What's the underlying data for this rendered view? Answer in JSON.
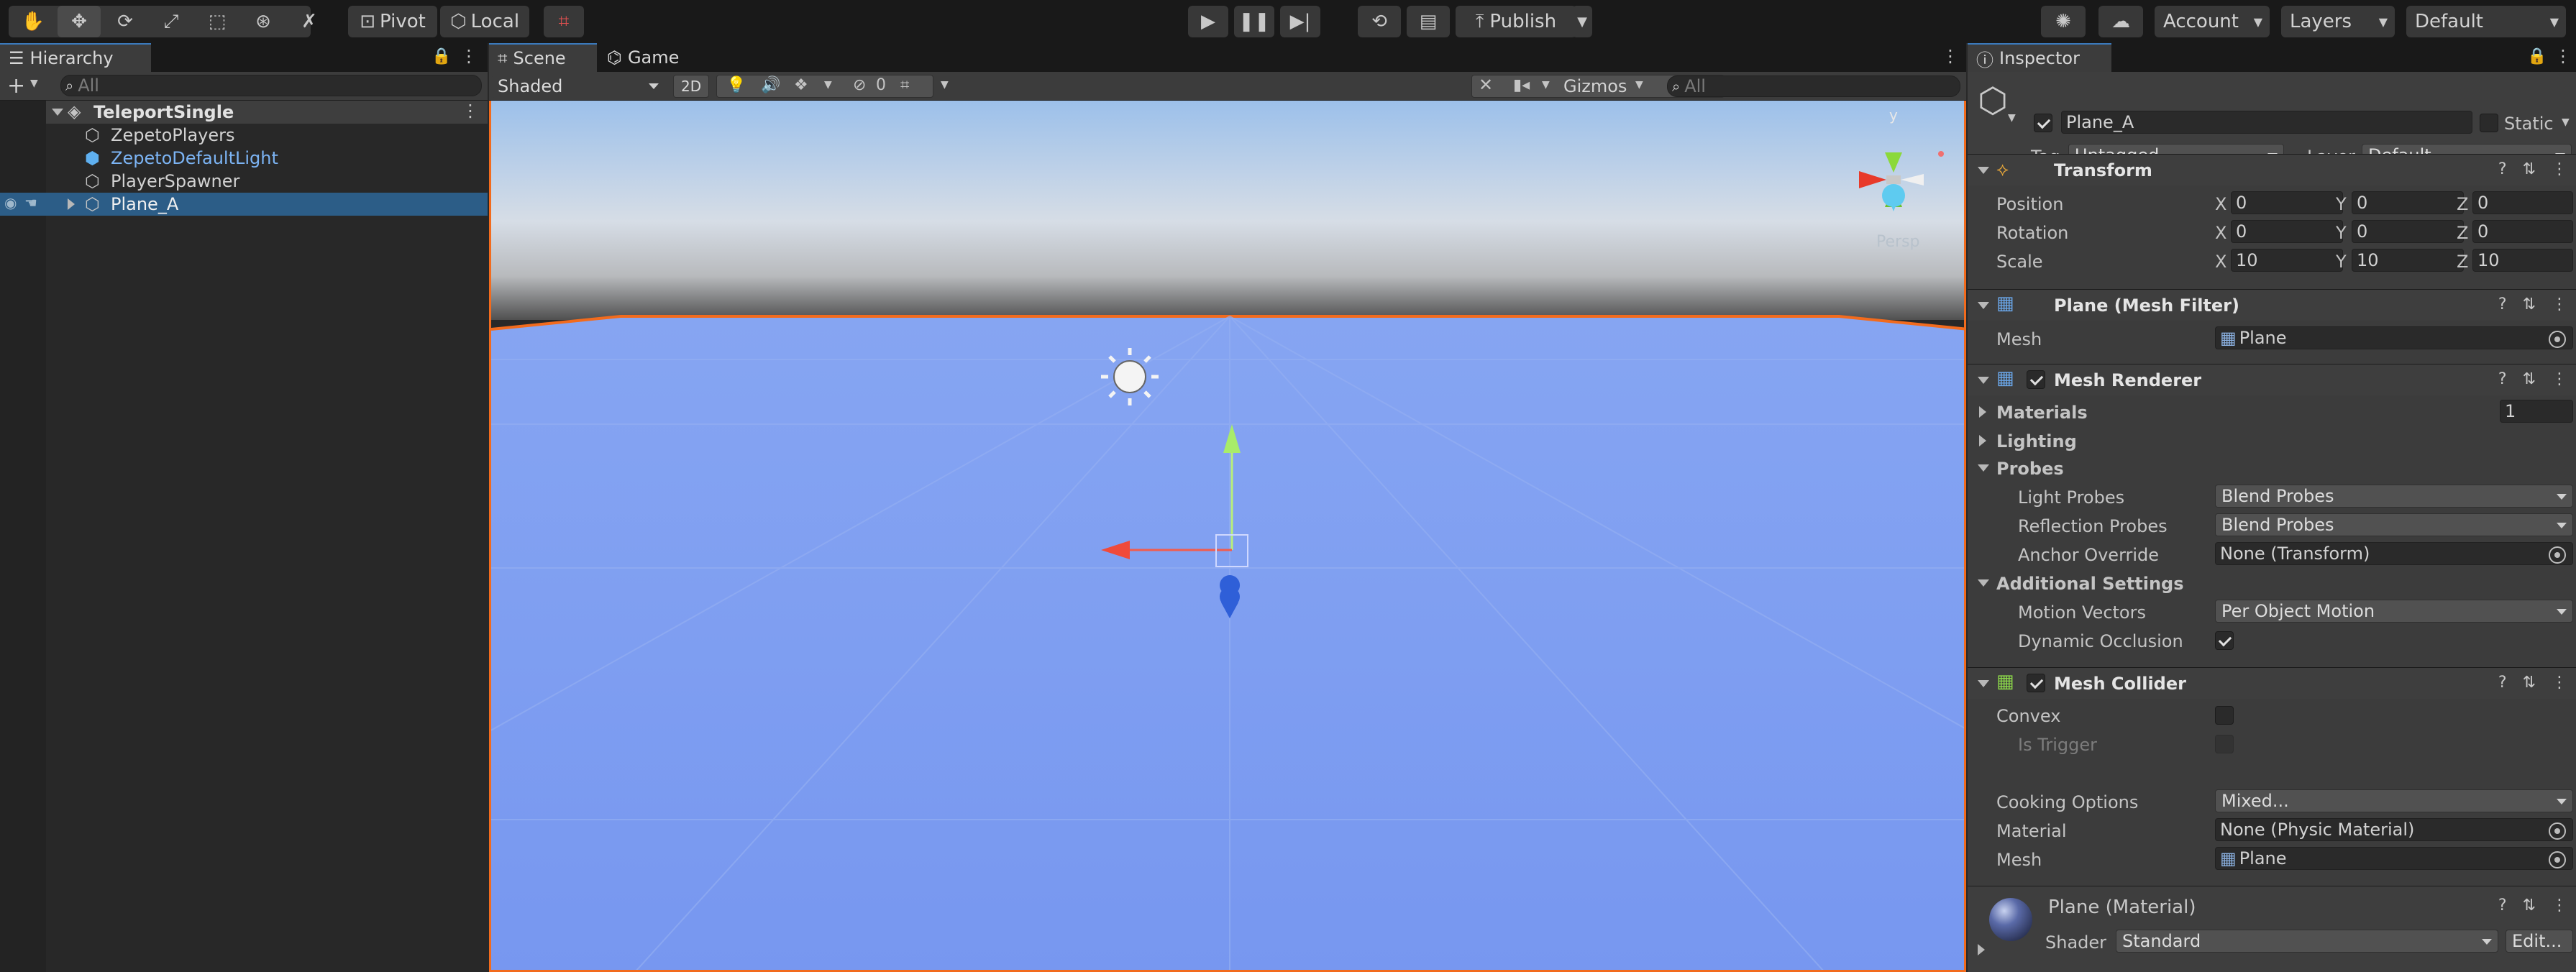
{
  "toolbar": {
    "pivot_label": "Pivot",
    "local_label": "Local",
    "publish_label": "Publish",
    "account_label": "Account",
    "layers_label": "Layers",
    "layout_label": "Default"
  },
  "hierarchy": {
    "tab_label": "Hierarchy",
    "search_placeholder": "All",
    "scene_name": "TeleportSingle",
    "items": [
      {
        "label": "ZepetoPlayers"
      },
      {
        "label": "ZepetoDefaultLight"
      },
      {
        "label": "PlayerSpawner"
      },
      {
        "label": "Plane_A"
      }
    ]
  },
  "scene": {
    "tabs": [
      {
        "label": "Scene"
      },
      {
        "label": "Game"
      }
    ],
    "shading_mode": "Shaded",
    "two_d_label": "2D",
    "hidden_count": "0",
    "gizmos_label": "Gizmos",
    "search_placeholder": "All",
    "persp_label": "Persp",
    "gizmo_axis_label": "y",
    "colors": {
      "sky_top": "#a8c8ee",
      "horizon": "#d8dde4",
      "ground": "#7c9ef4",
      "selection": "#f26b1d"
    }
  },
  "inspector": {
    "tab_label": "Inspector",
    "object_name": "Plane_A",
    "static_label": "Static",
    "tag_label": "Tag",
    "tag_value": "Untagged",
    "layer_label": "Layer",
    "layer_value": "Default",
    "transform": {
      "title": "Transform",
      "rows": [
        {
          "label": "Position",
          "x": "0",
          "y": "0",
          "z": "0"
        },
        {
          "label": "Rotation",
          "x": "0",
          "y": "0",
          "z": "0"
        },
        {
          "label": "Scale",
          "x": "10",
          "y": "10",
          "z": "10"
        }
      ],
      "axis_x": "X",
      "axis_y": "Y",
      "axis_z": "Z"
    },
    "mesh_filter": {
      "title": "Plane (Mesh Filter)",
      "mesh_label": "Mesh",
      "mesh_value": "Plane"
    },
    "mesh_renderer": {
      "title": "Mesh Renderer",
      "materials_label": "Materials",
      "materials_count": "1",
      "lighting_label": "Lighting",
      "probes_label": "Probes",
      "light_probes_label": "Light Probes",
      "light_probes_value": "Blend Probes",
      "reflection_probes_label": "Reflection Probes",
      "reflection_probes_value": "Blend Probes",
      "anchor_override_label": "Anchor Override",
      "anchor_override_value": "None (Transform)",
      "additional_settings_label": "Additional Settings",
      "motion_vectors_label": "Motion Vectors",
      "motion_vectors_value": "Per Object Motion",
      "dynamic_occlusion_label": "Dynamic Occlusion"
    },
    "mesh_collider": {
      "title": "Mesh Collider",
      "convex_label": "Convex",
      "is_trigger_label": "Is Trigger",
      "cooking_options_label": "Cooking Options",
      "cooking_options_value": "Mixed...",
      "material_label": "Material",
      "material_value": "None (Physic Material)",
      "mesh_label": "Mesh",
      "mesh_value": "Plane"
    },
    "material": {
      "title": "Plane (Material)",
      "shader_label": "Shader",
      "shader_value": "Standard",
      "edit_label": "Edit..."
    }
  }
}
